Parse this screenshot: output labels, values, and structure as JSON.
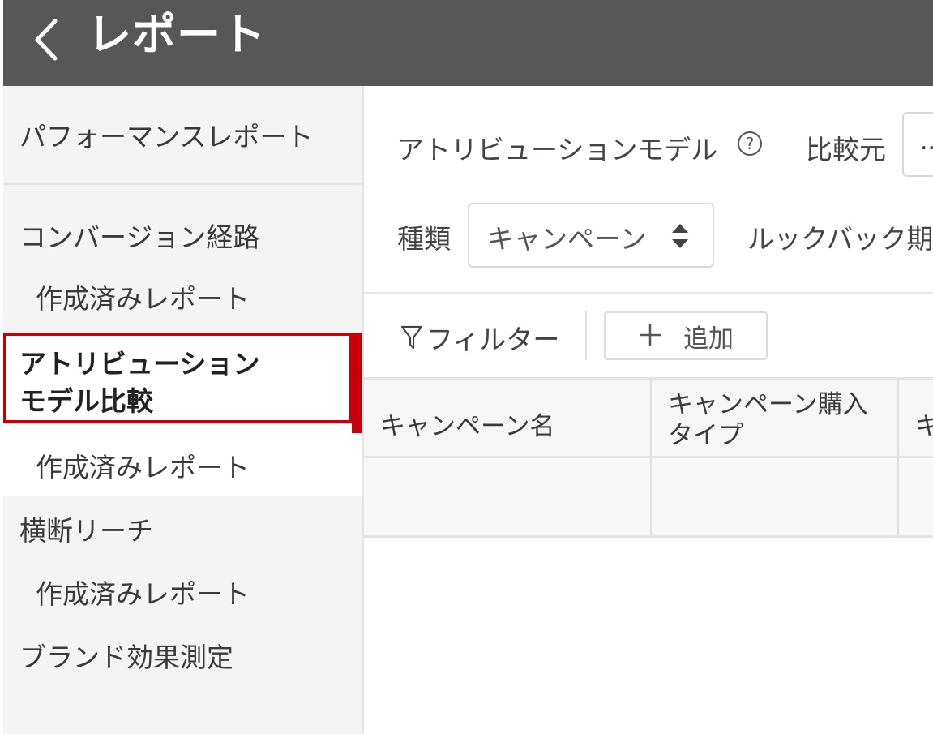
{
  "header": {
    "title": "レポート",
    "back_icon": "chevron-left-icon"
  },
  "sidebar": {
    "performance_report": "パフォーマンスレポート",
    "conversion_path": "コンバージョン経路",
    "conversion_path_saved": "作成済みレポート",
    "attribution_line1": "アトリビューション",
    "attribution_line2": "モデル比較",
    "attribution_saved": "作成済みレポート",
    "cross_reach": "横断リーチ",
    "cross_reach_saved": "作成済みレポート",
    "brand_effect": "ブランド効果測定",
    "active_color": "#c4000b"
  },
  "main": {
    "attribution_model_label": "アトリビューションモデル",
    "help_icon": "question-circle-icon",
    "compare_label": "比較元",
    "compare_value": "..",
    "type_label": "種類",
    "type_value": "キャンペーン",
    "lookback_label": "ルックバック期",
    "filter_label": "フィルター",
    "filter_icon": "funnel-icon",
    "add_label": "追加",
    "add_icon": "plus-icon"
  },
  "table": {
    "columns": [
      "キャンペーン名",
      "キャンペーン購入タイプ",
      "キ"
    ],
    "column2_line1": "キャンペーン購入",
    "column2_line2": "タイプ"
  },
  "colors": {
    "header_bg": "#575757",
    "sidebar_bg": "#f4f4f4",
    "accent": "#c4000b"
  }
}
